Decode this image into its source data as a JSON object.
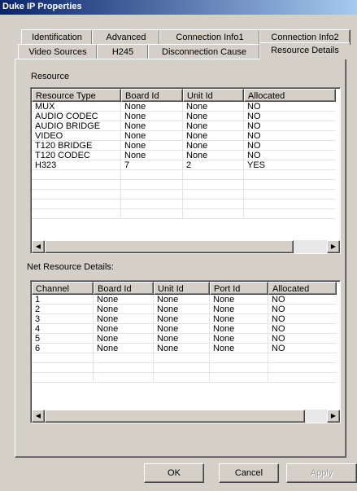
{
  "window": {
    "title": "Duke IP Properties"
  },
  "tabs_back": [
    "Identification",
    "Advanced",
    "Connection Info1",
    "Connection Info2"
  ],
  "tabs_front": [
    "Video Sources",
    "H245",
    "Disconnection Cause",
    "Resource Details"
  ],
  "active_tab": "Resource Details",
  "resource": {
    "label": "Resource",
    "columns": [
      "Resource Type",
      "Board Id",
      "Unit Id",
      "Allocated"
    ],
    "rows": [
      [
        "MUX",
        "None",
        "None",
        "NO"
      ],
      [
        "AUDIO CODEC",
        "None",
        "None",
        "NO"
      ],
      [
        "AUDIO BRIDGE",
        "None",
        "None",
        "NO"
      ],
      [
        "VIDEO",
        "None",
        "None",
        "NO"
      ],
      [
        "T120 BRIDGE",
        "None",
        "None",
        "NO"
      ],
      [
        "T120 CODEC",
        "None",
        "None",
        "NO"
      ],
      [
        "H323",
        "7",
        "2",
        "YES"
      ]
    ]
  },
  "net_resource": {
    "label": "Net Resource Details:",
    "columns": [
      "Channel",
      "Board Id",
      "Unit Id",
      "Port Id",
      "Allocated"
    ],
    "rows": [
      [
        "1",
        "None",
        "None",
        "None",
        "NO"
      ],
      [
        "2",
        "None",
        "None",
        "None",
        "NO"
      ],
      [
        "3",
        "None",
        "None",
        "None",
        "NO"
      ],
      [
        "4",
        "None",
        "None",
        "None",
        "NO"
      ],
      [
        "5",
        "None",
        "None",
        "None",
        "NO"
      ],
      [
        "6",
        "None",
        "None",
        "None",
        "NO"
      ]
    ]
  },
  "buttons": {
    "ok": "OK",
    "cancel": "Cancel",
    "apply": "Apply"
  },
  "colors": {
    "titlebar_start": "#0a246a",
    "titlebar_end": "#a6caf0",
    "face": "#d4d0c8"
  }
}
